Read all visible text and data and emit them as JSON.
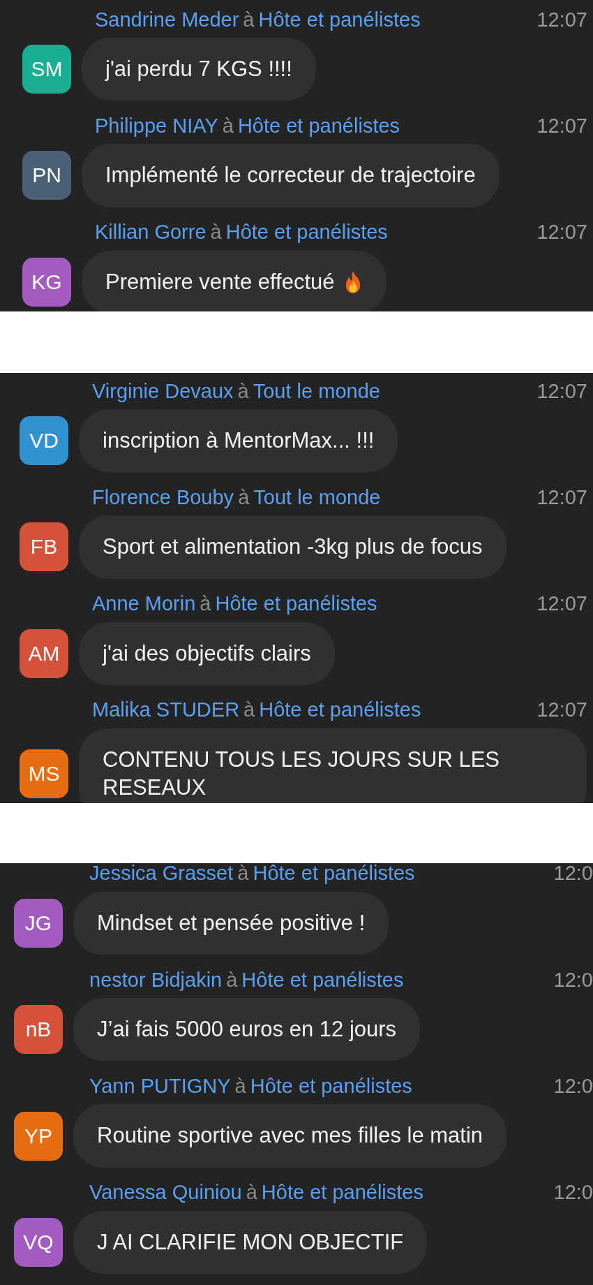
{
  "panels": [
    {
      "messages": [
        {
          "sender": "Sandrine Meder",
          "connector": "à",
          "recipient": "Hôte et panélistes",
          "time": "12:07",
          "initials": "SM",
          "color": "#1aaf93",
          "text": "j'ai perdu 7 KGS !!!!",
          "trailing_icon": false
        },
        {
          "sender": "Philippe NIAY",
          "connector": "à",
          "recipient": "Hôte et panélistes",
          "time": "12:07",
          "initials": "PN",
          "color": "#4a6175",
          "text": "Implémenté le correcteur de trajectoire",
          "trailing_icon": false
        },
        {
          "sender": "Killian Gorre",
          "connector": "à",
          "recipient": "Hôte et panélistes",
          "time": "12:07",
          "initials": "KG",
          "color": "#a25cc0",
          "text": "Premiere vente effectué",
          "trailing_icon": true
        }
      ]
    },
    {
      "messages": [
        {
          "sender": "Virginie Devaux",
          "connector": "à",
          "recipient": "Tout le monde",
          "time": "12:07",
          "initials": "VD",
          "color": "#3192d0",
          "text": "inscription à MentorMax... !!!",
          "trailing_icon": false
        },
        {
          "sender": "Florence Bouby",
          "connector": "à",
          "recipient": "Tout le monde",
          "time": "12:07",
          "initials": "FB",
          "color": "#d4523a",
          "text": "Sport et alimentation -3kg plus de focus",
          "trailing_icon": false
        },
        {
          "sender": "Anne Morin",
          "connector": "à",
          "recipient": "Hôte et panélistes",
          "time": "12:07",
          "initials": "AM",
          "color": "#d4523a",
          "text": "j'ai des objectifs clairs",
          "trailing_icon": false
        },
        {
          "sender": "Malika STUDER",
          "connector": "à",
          "recipient": "Hôte et panélistes",
          "time": "12:07",
          "initials": "MS",
          "color": "#e56c12",
          "text": "CONTENU TOUS LES JOURS SUR LES RESEAUX",
          "trailing_icon": false
        }
      ]
    },
    {
      "messages": [
        {
          "sender": "Jessica Grasset",
          "connector": "à",
          "recipient": "Hôte et panélistes",
          "time": "12:0",
          "initials": "JG",
          "color": "#a25cc0",
          "text": "Mindset et pensée positive !",
          "trailing_icon": false
        },
        {
          "sender": "nestor Bidjakin",
          "connector": "à",
          "recipient": "Hôte et panélistes",
          "time": "12:0",
          "initials": "nB",
          "color": "#d4523a",
          "text": "J’ai fais 5000 euros en 12 jours",
          "trailing_icon": false
        },
        {
          "sender": "Yann PUTIGNY",
          "connector": "à",
          "recipient": "Hôte et panélistes",
          "time": "12:0",
          "initials": "YP",
          "color": "#e56c12",
          "text": "Routine sportive avec mes filles le matin",
          "trailing_icon": false
        },
        {
          "sender": "Vanessa Quiniou",
          "connector": "à",
          "recipient": "Hôte et panélistes",
          "time": "12:0",
          "initials": "VQ",
          "color": "#a25cc0",
          "text": "J AI CLARIFIE MON OBJECTIF",
          "trailing_icon": false
        }
      ]
    }
  ]
}
